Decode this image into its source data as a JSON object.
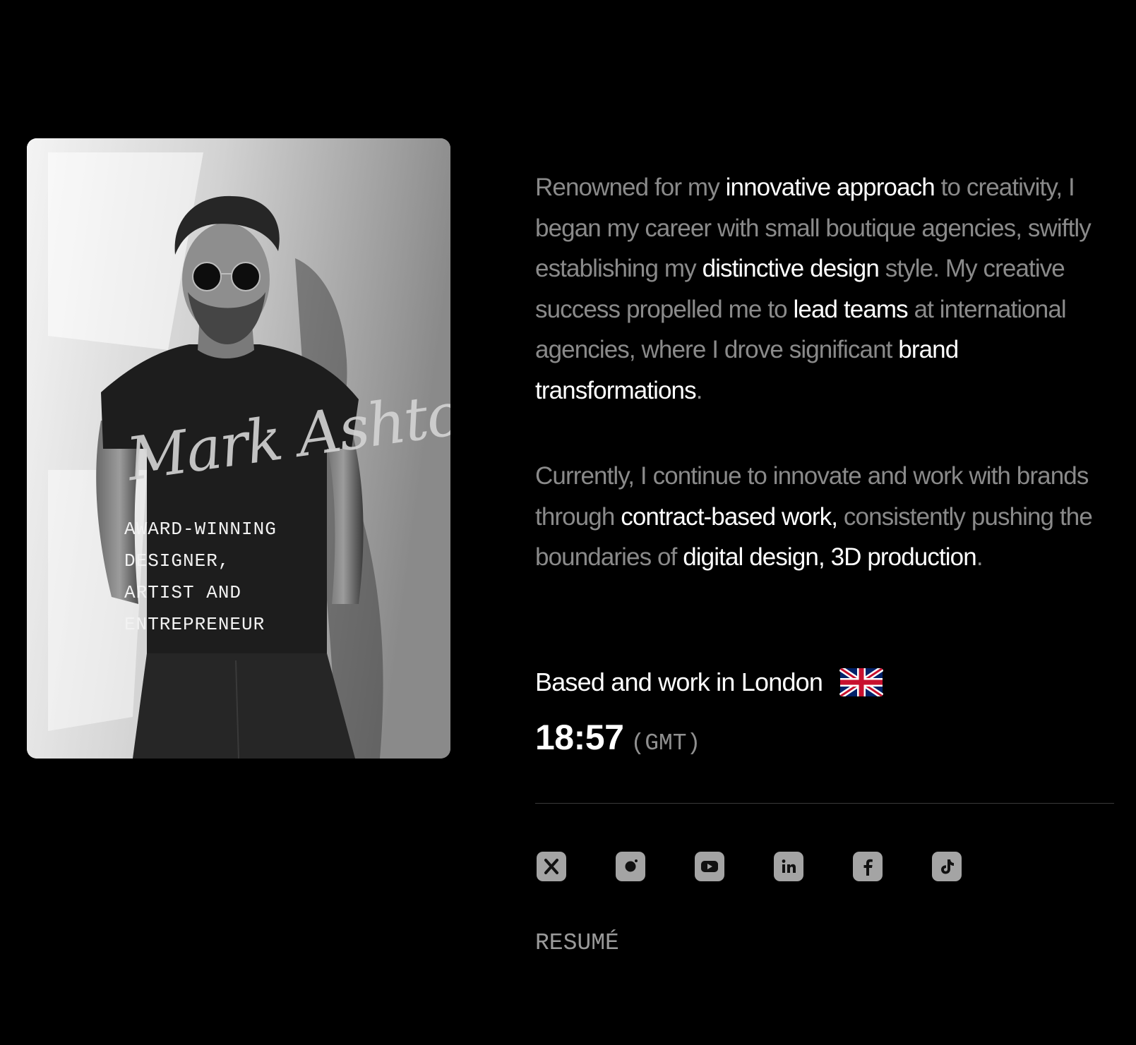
{
  "portrait": {
    "signature": "Mark Ashton",
    "tagline": [
      "AWARD-WINNING",
      "DESIGNER,",
      "ARTIST AND",
      "ENTREPRENEUR"
    ]
  },
  "bio": {
    "paragraph1": [
      {
        "text": "Renowned for my ",
        "highlight": false
      },
      {
        "text": "innovative approach",
        "highlight": true
      },
      {
        "text": " to creativity, I began my career with small boutique agencies, swiftly establishing my ",
        "highlight": false
      },
      {
        "text": "distinctive design",
        "highlight": true
      },
      {
        "text": " style. My creative success propelled me to ",
        "highlight": false
      },
      {
        "text": "lead teams",
        "highlight": true
      },
      {
        "text": " at international agencies, where I drove significant ",
        "highlight": false
      },
      {
        "text": "brand transformations",
        "highlight": true
      },
      {
        "text": ".",
        "highlight": false
      }
    ],
    "paragraph2": [
      {
        "text": "Currently, I continue to innovate and work with brands through ",
        "highlight": false
      },
      {
        "text": "contract-based work,",
        "highlight": true
      },
      {
        "text": " consistently pushing the boundaries of ",
        "highlight": false
      },
      {
        "text": "digital design, 3D production",
        "highlight": true
      },
      {
        "text": ".",
        "highlight": false
      }
    ]
  },
  "location": {
    "text": "Based and work in London",
    "flag_icon": "uk-flag-icon"
  },
  "clock": {
    "time": "18:57",
    "timezone": "(GMT)"
  },
  "socials": [
    {
      "name": "x-icon"
    },
    {
      "name": "instagram-icon"
    },
    {
      "name": "youtube-icon"
    },
    {
      "name": "linkedin-icon"
    },
    {
      "name": "facebook-icon"
    },
    {
      "name": "tiktok-icon"
    }
  ],
  "resume": {
    "label": "RESUMÉ"
  },
  "colors": {
    "background": "#000000",
    "text_highlight": "#ffffff",
    "text_muted": "#8a8a8a",
    "icon_fill": "#a4a4a4"
  }
}
